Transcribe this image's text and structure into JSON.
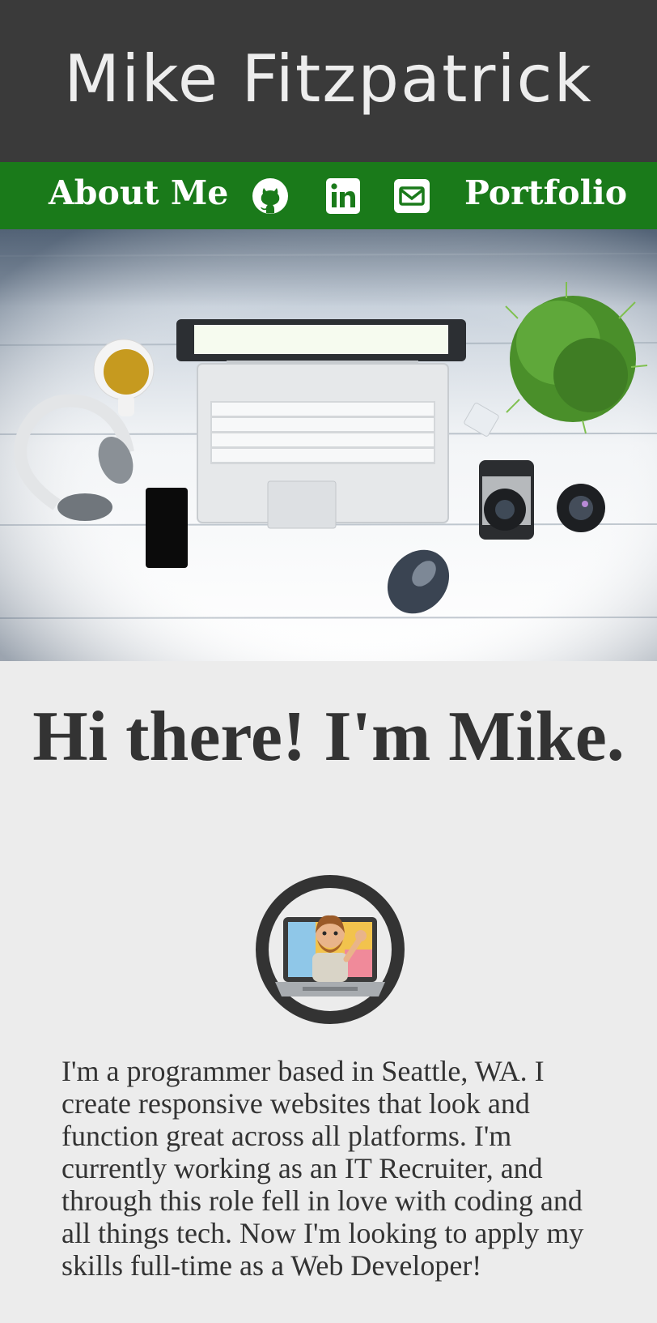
{
  "header": {
    "site_title": "Mike Fitzpatrick"
  },
  "nav": {
    "about_label": "About Me",
    "portfolio_label": "Portfolio",
    "icons": [
      "github-icon",
      "linkedin-icon",
      "mail-icon"
    ]
  },
  "main": {
    "greeting": "Hi there! I'm Mike.",
    "bio": "I'm a programmer based in Seattle, WA. I create responsive websites that look and function great across all platforms. I'm currently working as an IT Recruiter, and through this role fell in love with coding and all things tech. Now I'm looking to apply my skills full-time as a Web Developer!"
  },
  "colors": {
    "header_bg": "#3a3a3a",
    "nav_bg": "#1a7a1a",
    "page_bg": "#ececec",
    "text": "#333333"
  }
}
